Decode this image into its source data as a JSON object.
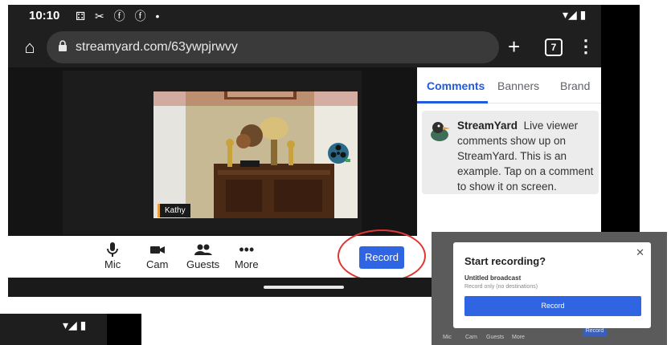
{
  "status_bar": {
    "time": "10:10",
    "left_icons": "⚃ ✂ ⓕ ⓕ •",
    "right_icons": "▾◢ ▮"
  },
  "browser": {
    "url": "streamyard.com/63ywpjrwvy",
    "tab_count": "7"
  },
  "stage": {
    "participant_name": "Kathy"
  },
  "side_panel": {
    "tabs": [
      {
        "label": "Comments"
      },
      {
        "label": "Banners"
      },
      {
        "label": "Brand"
      }
    ],
    "comment": {
      "author": "StreamYard",
      "text": "Live viewer comments show up on StreamYard. This is an example. Tap on a comment to show it on screen."
    }
  },
  "controls": {
    "mic": "Mic",
    "cam": "Cam",
    "guests": "Guests",
    "more": "More",
    "record": "Record"
  },
  "mini_status": {
    "right_icons": "▾◢ ▮"
  },
  "dialog": {
    "title": "Start recording?",
    "broadcast_name": "Untitled broadcast",
    "subtitle": "Record only (no destinations)",
    "record_button": "Record",
    "background_controls": [
      "Mic",
      "Cam",
      "Guests",
      "More"
    ],
    "background_record": "Record"
  },
  "colors": {
    "accent": "#2f65e3",
    "highlight_ring": "#e03535"
  }
}
